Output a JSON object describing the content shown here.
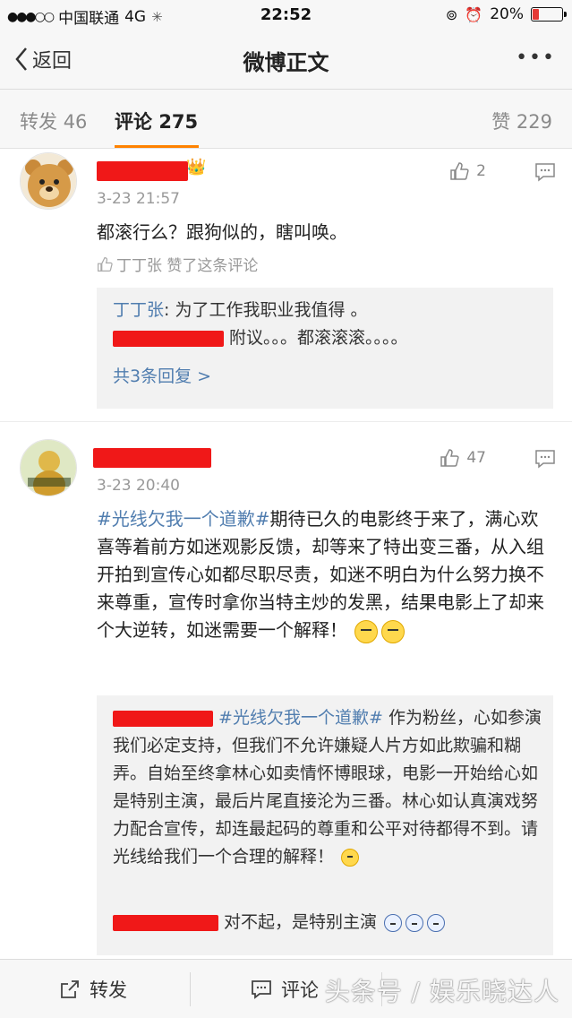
{
  "status_bar": {
    "carrier": "中国联通",
    "network": "4G",
    "time": "22:52",
    "battery": "20%",
    "battery_level": 0.2
  },
  "nav": {
    "back_label": "返回",
    "title": "微博正文",
    "more": "•••"
  },
  "tabs": {
    "repost_label": "转发",
    "repost_count": "46",
    "comment_label": "评论",
    "comment_count": "275",
    "like_label": "赞",
    "like_count": "229"
  },
  "comments": [
    {
      "time": "3-23 21:57",
      "likes": "2",
      "text": "都滚行么？跟狗似的，瞎叫唤。",
      "liked_by": "丁丁张 赞了这条评论",
      "replies": [
        {
          "user": "丁丁张",
          "text": ": 为了工作我职业我值得 。"
        },
        {
          "user": "",
          "text": "附议。。。都滚滚滚。。。。"
        }
      ],
      "reply_more": "共3条回复 >"
    },
    {
      "time": "3-23 20:40",
      "likes": "47",
      "topic": "#光线欠我一个道歉#",
      "text": "期待已久的电影终于来了，满心欢喜等着前方如迷观影反馈，却等来了特出变三番，从入组开拍到宣传心如都尽职尽责，如迷不明白为什么努力换不来尊重，宣传时拿你当特主炒的发黑，结果电影上了却来个大逆转，如迷需要一个解释！",
      "replies": [
        {
          "topic": "#光线欠我一个道歉#",
          "text": "作为粉丝，心如参演我们必定支持，但我们不允许嫌疑人片方如此欺骗和糊弄。自始至终拿林心如卖情怀博眼球，电影一开始给心如是特别主演，最后片尾直接沦为三番。林心如认真演戏努力配合宣传，却连最起码的尊重和公平对待都得不到。请光线给我们一个合理的解释！"
        },
        {
          "text": "对不起，是特别主演"
        }
      ]
    }
  ],
  "bottom_bar": {
    "repost_label": "转发",
    "comment_label": "评论",
    "watermark": "头条号 / 娱乐晓达人"
  },
  "colors": {
    "accent": "#ff8200",
    "link": "#507daf",
    "redaction": "#f01818"
  }
}
